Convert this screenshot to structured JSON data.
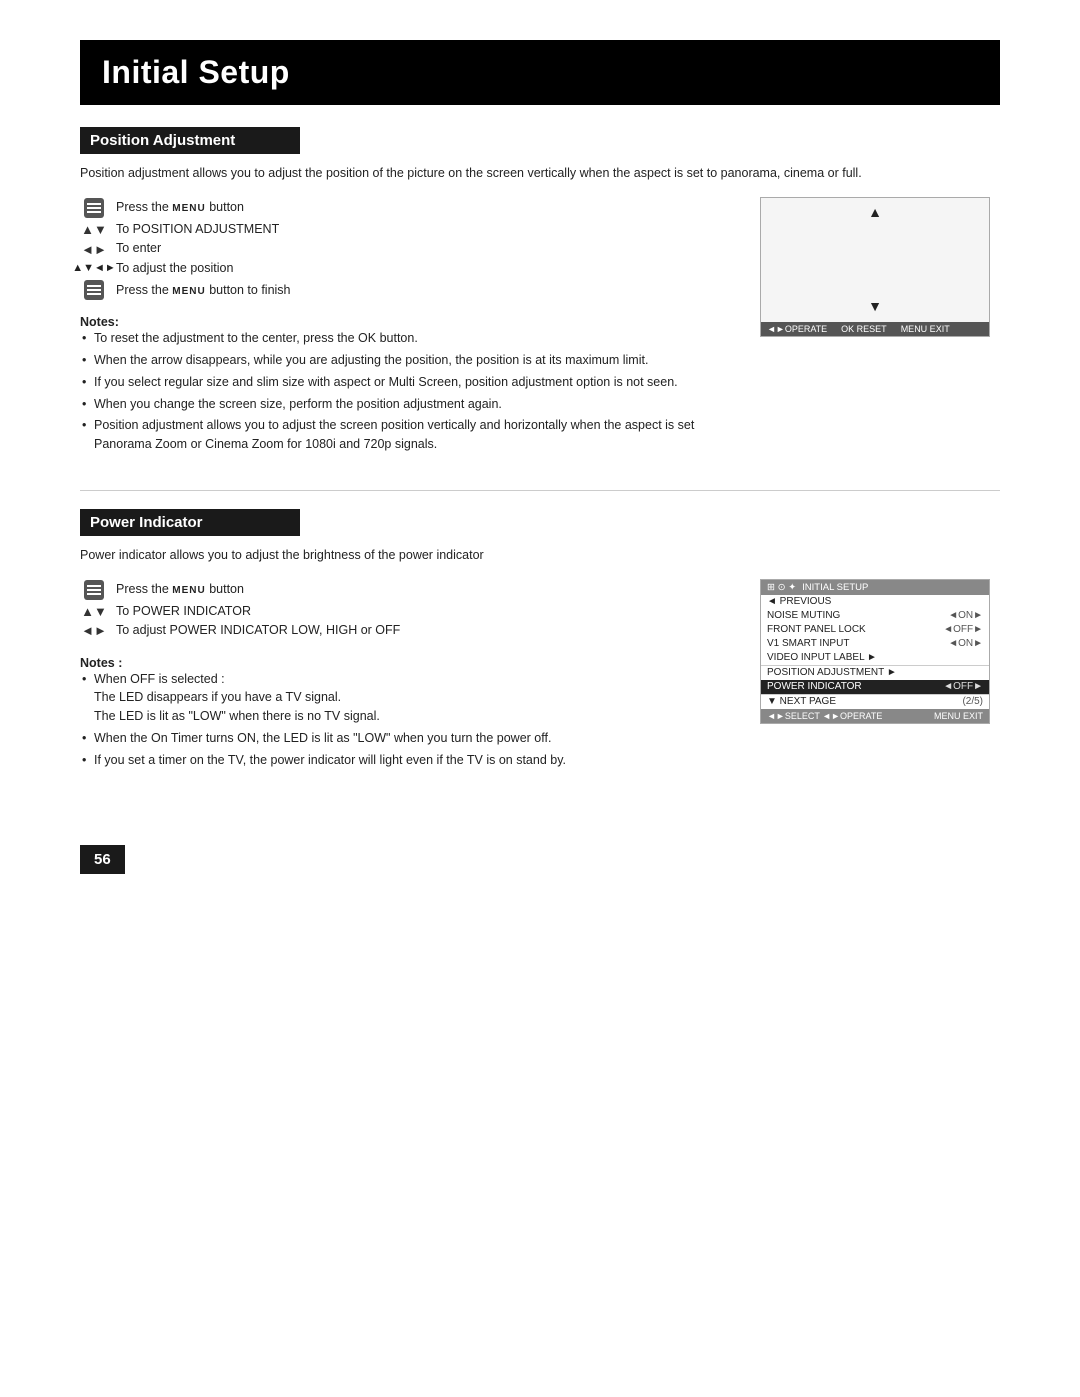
{
  "page": {
    "title": "Initial Setup",
    "page_number": "56"
  },
  "section1": {
    "header": "Position Adjustment",
    "description": "Position adjustment allows you to adjust the position of the picture on the screen vertically when the aspect is set to panorama, cinema or full.",
    "instructions": [
      {
        "icon": "menu-icon",
        "text": "Press the MENU button",
        "small_caps": "MENU"
      },
      {
        "icon": "arrow-ud",
        "text": "To POSITION ADJUSTMENT"
      },
      {
        "icon": "arrow-lr",
        "text": "To enter"
      },
      {
        "icon": "arrow-ud-lr",
        "text": "To adjust the position"
      },
      {
        "icon": "menu-icon",
        "text": "Press the MENU button to finish",
        "small_caps": "MENU"
      }
    ],
    "screen": {
      "arrow_up": "▲",
      "arrow_down": "▼",
      "bottom_bar": [
        {
          "label": "◄►  OPERATE"
        },
        {
          "label": "OK  RESET"
        },
        {
          "label": "MENU  EXIT"
        }
      ]
    },
    "notes_label": "Notes:",
    "notes": [
      "To reset the adjustment to the center, press the OK button.",
      "When the arrow disappears, while you are adjusting the position, the position is at its maximum limit.",
      "If you select regular size and slim size with aspect or Multi Screen, position adjustment option is not seen.",
      "When you change the screen size, perform the position adjustment again.",
      "Position adjustment allows you to adjust the screen position vertically and horizontally when the aspect is set Panorama Zoom or Cinema Zoom for 1080i and 720p signals."
    ]
  },
  "section2": {
    "header": "Power Indicator",
    "description": "Power indicator allows you to adjust the brightness of the power indicator",
    "instructions": [
      {
        "icon": "menu-icon",
        "text": "Press the MENU button",
        "small_caps": "MENU"
      },
      {
        "icon": "arrow-ud",
        "text": "To POWER INDICATOR"
      },
      {
        "icon": "arrow-lr",
        "text": "To adjust POWER INDICATOR LOW, HIGH or OFF"
      }
    ],
    "menu": {
      "title_bar": "⊞  ⊙  ✦  INITIAL SETUP",
      "rows": [
        {
          "label": "◄ PREVIOUS",
          "value": "",
          "highlighted": false
        },
        {
          "label": "NOISE MUTING",
          "value": "◄ON►",
          "highlighted": false
        },
        {
          "label": "FRONT PANEL LOCK",
          "value": "◄OFF►",
          "highlighted": false
        },
        {
          "label": "V1 SMART INPUT",
          "value": "◄ON►",
          "highlighted": false
        },
        {
          "label": "VIDEO INPUT LABEL ►",
          "value": "",
          "highlighted": false
        },
        {
          "label": "POSITION ADJUSTMENT ►",
          "value": "",
          "highlighted": false
        },
        {
          "label": "POWER INDICATOR",
          "value": "◄OFF►",
          "highlighted": true
        },
        {
          "label": "▼ NEXT PAGE",
          "value": "(2/5)",
          "highlighted": false
        }
      ],
      "bottom_bar": "◄►SELECT  ◄►OPERATE      MENU EXIT"
    },
    "notes_label": "Notes :",
    "notes": [
      "When OFF is selected :\nThe LED disappears if you have a TV signal.\nThe LED is lit as \"LOW\" when there is no TV signal.",
      "When the On Timer turns ON, the LED is lit as \"LOW\" when you turn the power off.",
      "If you set a timer on the TV, the power indicator will light even if the TV is on stand by."
    ]
  }
}
